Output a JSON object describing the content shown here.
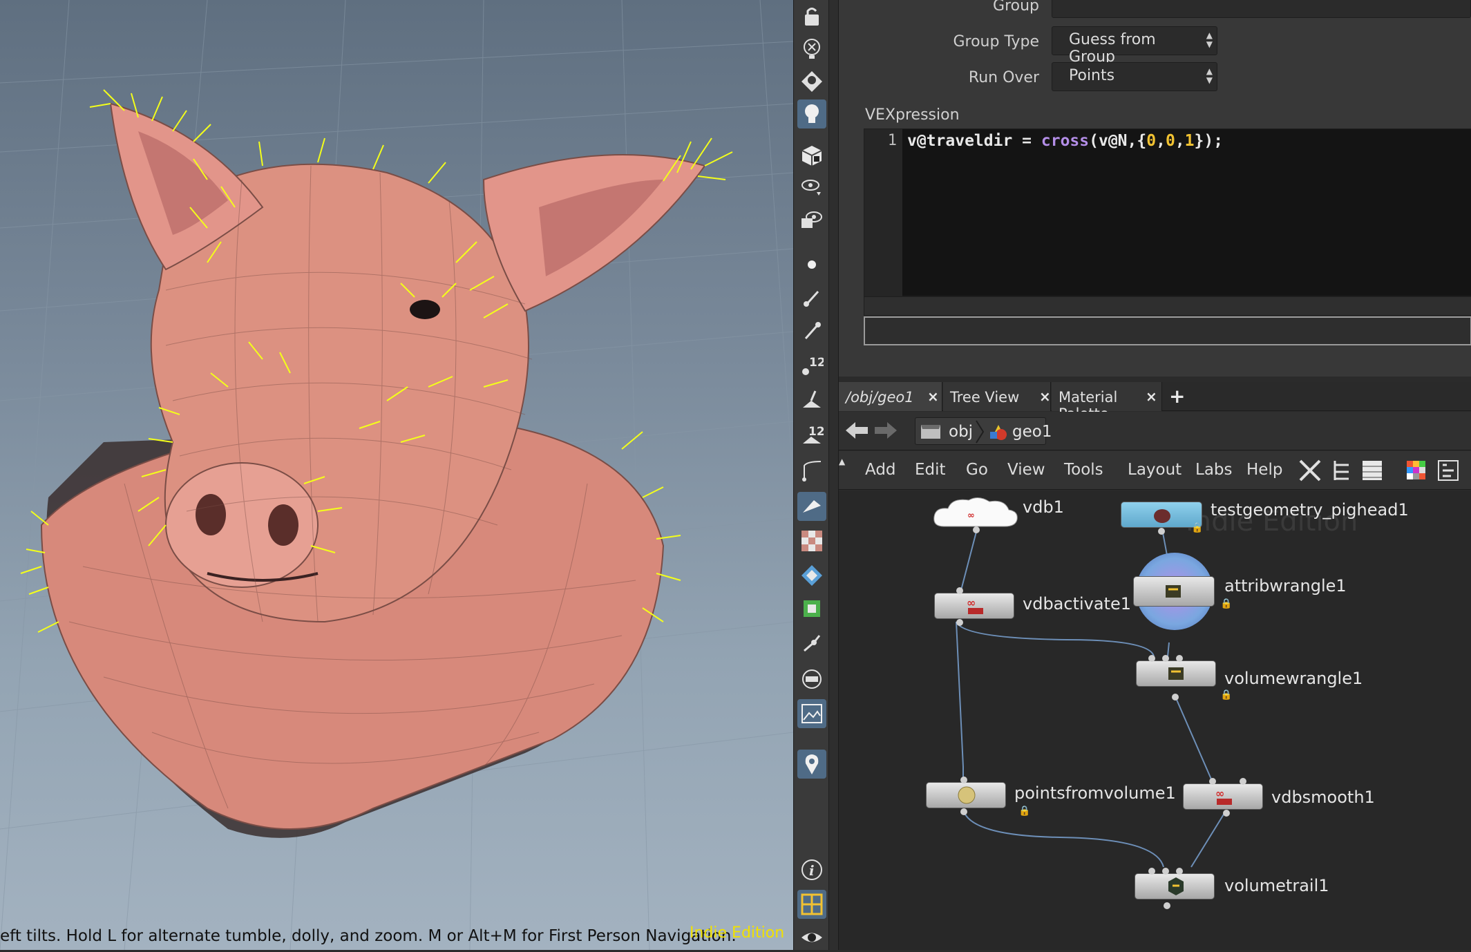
{
  "viewport": {
    "status_hint": "eft tilts. Hold L for alternate tumble, dolly, and zoom. M or Alt+M for First Person Navigation.",
    "watermark": "Indie Edition",
    "watermark_color": "#f1e100",
    "hair_color": "#f4ff1a",
    "skin_color": "#d7897b"
  },
  "shelf": {
    "tools": [
      "lock-icon",
      "ghost-icon",
      "light-bulb-icon",
      "light-bulb-active-icon",
      "shading-cube-icon",
      "eye-display-icon",
      "eye-camera-icon",
      "point-icon",
      "brush-icon",
      "pipette-icon",
      "point-numbers-icon",
      "prim-normal-icon",
      "prim-numbers-icon",
      "edge-icon",
      "select-pen-icon",
      "texture-checker-icon",
      "diamond-icon",
      "uv-icon",
      "snap-icon",
      "grid-icon",
      "background-image-icon",
      "pin-icon",
      "info-icon",
      "layout-quad-icon",
      "eye-icon"
    ]
  },
  "params": {
    "group_label": "Group",
    "group_value": "",
    "group_type_label": "Group Type",
    "group_type_value": "Guess from Group",
    "run_over_label": "Run Over",
    "run_over_value": "Points",
    "vex_label": "VEXpression",
    "vex_line_number": "1",
    "vex_code": {
      "attr": "v@traveldir",
      "op": " = ",
      "func": "cross",
      "open": "(",
      "arg1": "v@N",
      "comma1": ",{",
      "n0a": "0",
      "c2": ",",
      "n0b": "0",
      "c3": ",",
      "n1": "1",
      "close": "});"
    }
  },
  "tabs": {
    "tab1": "/obj/geo1",
    "tab2": "Tree View",
    "tab3": "Material Palette",
    "add": "+"
  },
  "path": {
    "obj": "obj",
    "geo": "geo1"
  },
  "menu": [
    "Add",
    "Edit",
    "Go",
    "View",
    "Tools",
    "Layout",
    "Labs",
    "Help"
  ],
  "network": {
    "watermark": "Indie Edition",
    "nodes": {
      "vdb1": "vdb1",
      "pighead": "testgeometry_pighead1",
      "vdbactivate": "vdbactivate1",
      "attribwrangle": "attribwrangle1",
      "volumewrangle": "volumewrangle1",
      "pointsfromvolume": "pointsfromvolume1",
      "vdbsmooth": "vdbsmooth1",
      "volumetrail": "volumetrail1"
    }
  }
}
